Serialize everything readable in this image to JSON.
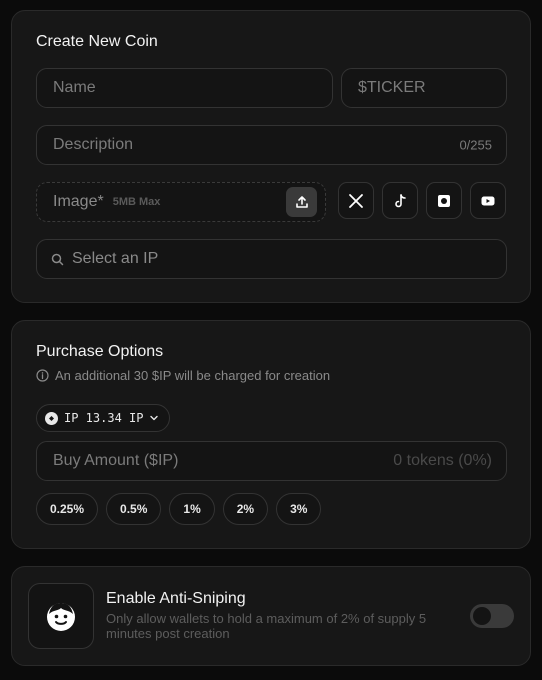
{
  "create": {
    "title": "Create New Coin",
    "name_placeholder": "Name",
    "ticker_placeholder": "$TICKER",
    "description_placeholder": "Description",
    "description_counter": "0/255",
    "image_label": "Image*",
    "image_hint": "5MB Max",
    "ip_placeholder": "Select an IP",
    "socials": [
      "x-icon",
      "tiktok-icon",
      "instagram-icon",
      "youtube-icon"
    ]
  },
  "purchase": {
    "title": "Purchase Options",
    "info": "An additional 30 $IP will be charged for creation",
    "balance": "IP 13.34 IP",
    "amount_placeholder": "Buy Amount ($IP)",
    "tokens_estimate": "0 tokens (0%)",
    "presets": [
      "0.25%",
      "0.5%",
      "1%",
      "2%",
      "3%"
    ]
  },
  "anti_sniping": {
    "title": "Enable Anti-Sniping",
    "description": "Only allow wallets to hold a maximum of 2% of supply 5 minutes post creation",
    "enabled": false
  },
  "colors": {
    "background": "#0b0b0b",
    "card": "#171717",
    "border": "#2a2a2a",
    "muted_text": "#7b7b7b"
  }
}
